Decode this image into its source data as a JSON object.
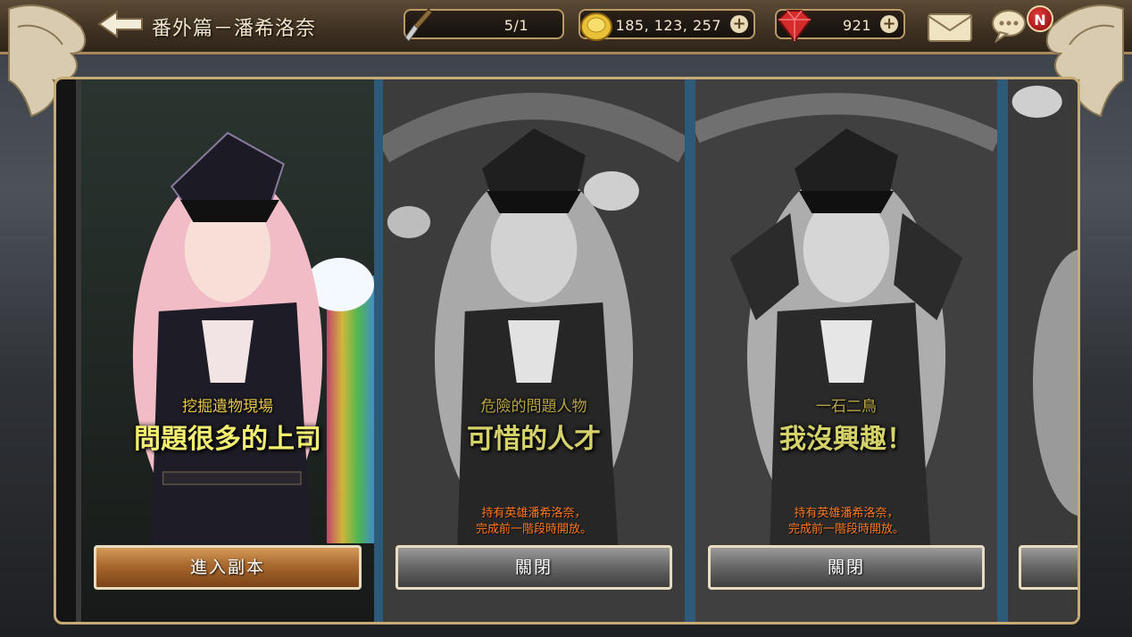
{
  "header": {
    "title": "番外篇－潘希洛奈",
    "stamina": "5/1",
    "gold": "185, 123, 257",
    "gems": "921",
    "notification_badge": "N"
  },
  "cards": [
    {
      "subtitle": "挖掘遺物現場",
      "title": "問題很多的上司",
      "requirement_line1": "",
      "requirement_line2": "",
      "button": "進入副本",
      "locked": false
    },
    {
      "subtitle": "危險的問題人物",
      "title": "可惜的人才",
      "requirement_line1": "持有英雄潘希洛奈，",
      "requirement_line2": "完成前一階段時開放。",
      "button": "關閉",
      "locked": true
    },
    {
      "subtitle": "一石二鳥",
      "title": "我沒興趣！",
      "requirement_line1": "持有英雄潘希洛奈，",
      "requirement_line2": "完成前一階段時開放。",
      "button": "關閉",
      "locked": true
    }
  ],
  "colors": {
    "accent_gold": "#c8aa74",
    "enter_button": "#a9682e",
    "closed_button": "#6a6a6a",
    "requirement_text": "#ff7a24",
    "title_text": "#f3f071"
  },
  "icons": [
    "back-arrow-icon",
    "shovel-icon",
    "gold-coin-icon",
    "ruby-gem-icon",
    "mail-icon",
    "chat-icon"
  ]
}
